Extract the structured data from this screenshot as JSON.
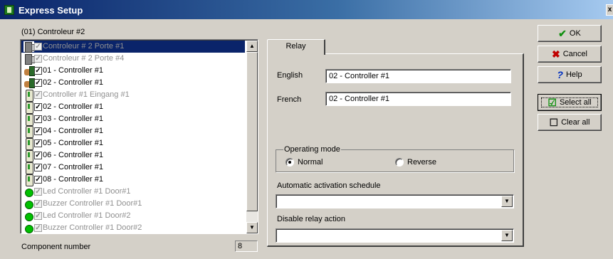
{
  "window": {
    "title": "Express Setup",
    "close_glyph": "x"
  },
  "section_label": "(01) Controleur #2",
  "list": {
    "items": [
      {
        "label": "Controleur # 2 Porte #1",
        "icon": "door-icon",
        "checked": true,
        "disabled": true,
        "selected": true
      },
      {
        "label": "Controleur # 2 Porte #4",
        "icon": "door-icon",
        "checked": true,
        "disabled": true,
        "selected": false
      },
      {
        "label": "01 - Controller #1",
        "icon": "hand-reader-icon",
        "checked": true,
        "disabled": false,
        "selected": false
      },
      {
        "label": "02 - Controller #1",
        "icon": "hand-reader-icon",
        "checked": true,
        "disabled": false,
        "selected": false
      },
      {
        "label": "Controller #1 Eingang #1",
        "icon": "relay-icon",
        "checked": true,
        "disabled": true,
        "selected": false
      },
      {
        "label": "02 - Controller #1",
        "icon": "relay-icon",
        "checked": true,
        "disabled": false,
        "selected": false
      },
      {
        "label": "03 - Controller #1",
        "icon": "relay-icon",
        "checked": true,
        "disabled": false,
        "selected": false
      },
      {
        "label": "04 - Controller #1",
        "icon": "relay-icon",
        "checked": true,
        "disabled": false,
        "selected": false
      },
      {
        "label": "05 - Controller #1",
        "icon": "relay-icon",
        "checked": true,
        "disabled": false,
        "selected": false
      },
      {
        "label": "06 - Controller #1",
        "icon": "relay-icon",
        "checked": true,
        "disabled": false,
        "selected": false
      },
      {
        "label": "07 - Controller #1",
        "icon": "relay-icon",
        "checked": true,
        "disabled": false,
        "selected": false
      },
      {
        "label": "08 - Controller #1",
        "icon": "relay-icon",
        "checked": true,
        "disabled": false,
        "selected": false
      },
      {
        "label": "Led Controller #1 Door#1",
        "icon": "led-icon",
        "checked": true,
        "disabled": true,
        "selected": false
      },
      {
        "label": "Buzzer Controller #1 Door#1",
        "icon": "led-icon",
        "checked": true,
        "disabled": true,
        "selected": false
      },
      {
        "label": "Led Controller #1 Door#2",
        "icon": "led-icon",
        "checked": true,
        "disabled": true,
        "selected": false
      },
      {
        "label": "Buzzer Controller #1 Door#2",
        "icon": "led-icon",
        "checked": true,
        "disabled": true,
        "selected": false
      }
    ]
  },
  "status": {
    "label": "Component number",
    "value": "8"
  },
  "tab": {
    "label": "Relay"
  },
  "fields": {
    "english_label": "English",
    "english_value": "02 - Controller #1",
    "french_label": "French",
    "french_value": "02 - Controller #1"
  },
  "operating_mode": {
    "title": "Operating mode",
    "normal_label": "Normal",
    "reverse_label": "Reverse",
    "selected": "Normal"
  },
  "schedule": {
    "label": "Automatic activation schedule",
    "value": ""
  },
  "disable_action": {
    "label": "Disable relay action",
    "value": ""
  },
  "buttons": {
    "ok": "OK",
    "cancel": "Cancel",
    "help": "Help",
    "select_all": "Select all",
    "clear_all": "Clear all"
  },
  "colors": {
    "selection": "#0a246a",
    "title_bar": "#0a246a",
    "face": "#d4d0c8"
  }
}
